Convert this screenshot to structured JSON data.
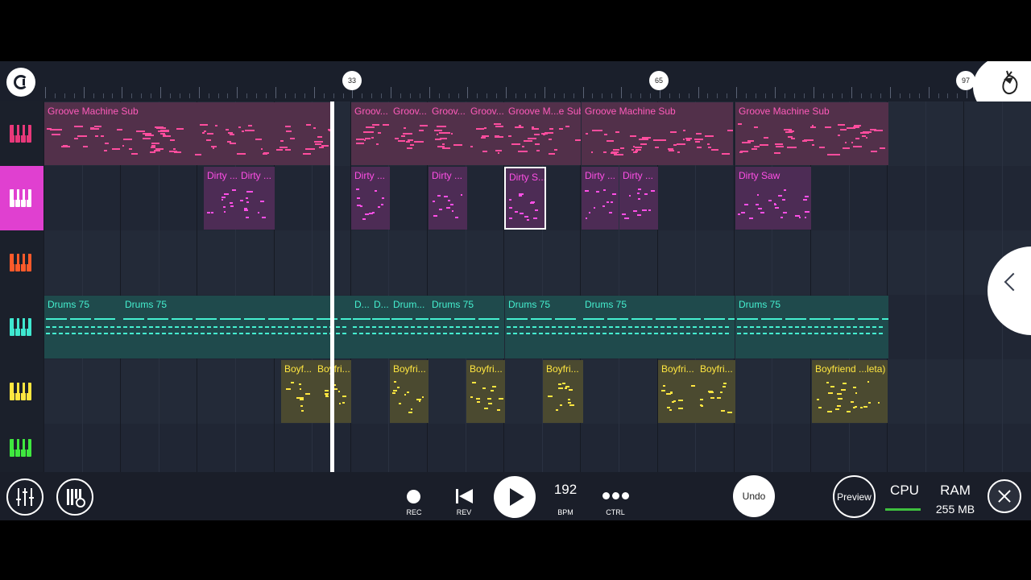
{
  "timeline": {
    "markers": [
      "33",
      "65",
      "97"
    ]
  },
  "tracks": [
    {
      "id": "t1",
      "color": "#e8387a",
      "level_color": "#e8387a",
      "selected": false,
      "clips": [
        {
          "name": "Groove Machine Sub",
          "style": "pink"
        },
        {
          "name": "Groov...",
          "style": "pink"
        },
        {
          "name": "Groov...",
          "style": "pink"
        },
        {
          "name": "Groov...",
          "style": "pink"
        },
        {
          "name": "Groov...",
          "style": "pink"
        },
        {
          "name": "Groove M...e Sub",
          "style": "pink"
        },
        {
          "name": "Groove Machine Sub",
          "style": "pink"
        },
        {
          "name": "Groove Machine Sub",
          "style": "pink"
        }
      ]
    },
    {
      "id": "t2",
      "color": "#ffffff",
      "level_color": "#e040d0",
      "selected": true,
      "clips": [
        {
          "name": "Dirty ...",
          "style": "mag"
        },
        {
          "name": "Dirty ...",
          "style": "mag"
        },
        {
          "name": "Dirty ...",
          "style": "mag"
        },
        {
          "name": "Dirty ...",
          "style": "mag"
        },
        {
          "name": "Dirty S...",
          "style": "mag",
          "selected": true
        },
        {
          "name": "Dirty ...",
          "style": "mag"
        },
        {
          "name": "Dirty ...",
          "style": "mag"
        },
        {
          "name": "Dirty Saw",
          "style": "mag"
        }
      ]
    },
    {
      "id": "t3",
      "color": "#ff5a2a",
      "level_color": "#ff5a2a",
      "selected": false,
      "clips": []
    },
    {
      "id": "t4",
      "color": "#3fe8d0",
      "level_color": "#3fe8d0",
      "selected": false,
      "clips": [
        {
          "name": "Drums 75",
          "style": "teal"
        },
        {
          "name": "Drums 75",
          "style": "teal"
        },
        {
          "name": "D...",
          "style": "teal"
        },
        {
          "name": "D...",
          "style": "teal"
        },
        {
          "name": "Drum...",
          "style": "teal"
        },
        {
          "name": "Drums 75",
          "style": "teal"
        },
        {
          "name": "Drums 75",
          "style": "teal"
        },
        {
          "name": "Drums 75",
          "style": "teal"
        },
        {
          "name": "Drums 75",
          "style": "teal"
        }
      ]
    },
    {
      "id": "t5",
      "color": "#ffe640",
      "level_color": "#ffe640",
      "selected": false,
      "clips": [
        {
          "name": "Boyf...",
          "style": "yel"
        },
        {
          "name": "Boyfri...",
          "style": "yel"
        },
        {
          "name": "Boyfri...",
          "style": "yel"
        },
        {
          "name": "Boyfri...",
          "style": "yel"
        },
        {
          "name": "Boyfri...",
          "style": "yel"
        },
        {
          "name": "Boyfri...",
          "style": "yel"
        },
        {
          "name": "Boyfri...",
          "style": "yel"
        },
        {
          "name": "Boyfriend ...leta)",
          "style": "yel"
        }
      ]
    },
    {
      "id": "t6",
      "color": "#3fe83f",
      "level_color": "#3fe83f",
      "selected": false,
      "clips": []
    }
  ],
  "toolbar": {
    "rec_label": "REC",
    "rev_label": "REV",
    "bpm_value": "192",
    "bpm_label": "BPM",
    "ctrl_label": "CTRL",
    "undo_label": "Undo",
    "preview_label": "Preview",
    "cpu_label": "CPU",
    "ram_label": "RAM",
    "ram_value": "255 MB"
  },
  "icons": [
    "magnet-snap-icon",
    "fl-fruit-logo-icon",
    "mixer-icon",
    "piano-settings-icon",
    "record-icon",
    "rewind-icon",
    "play-icon",
    "more-dots-icon",
    "close-icon",
    "collapse-chevron-icon"
  ]
}
